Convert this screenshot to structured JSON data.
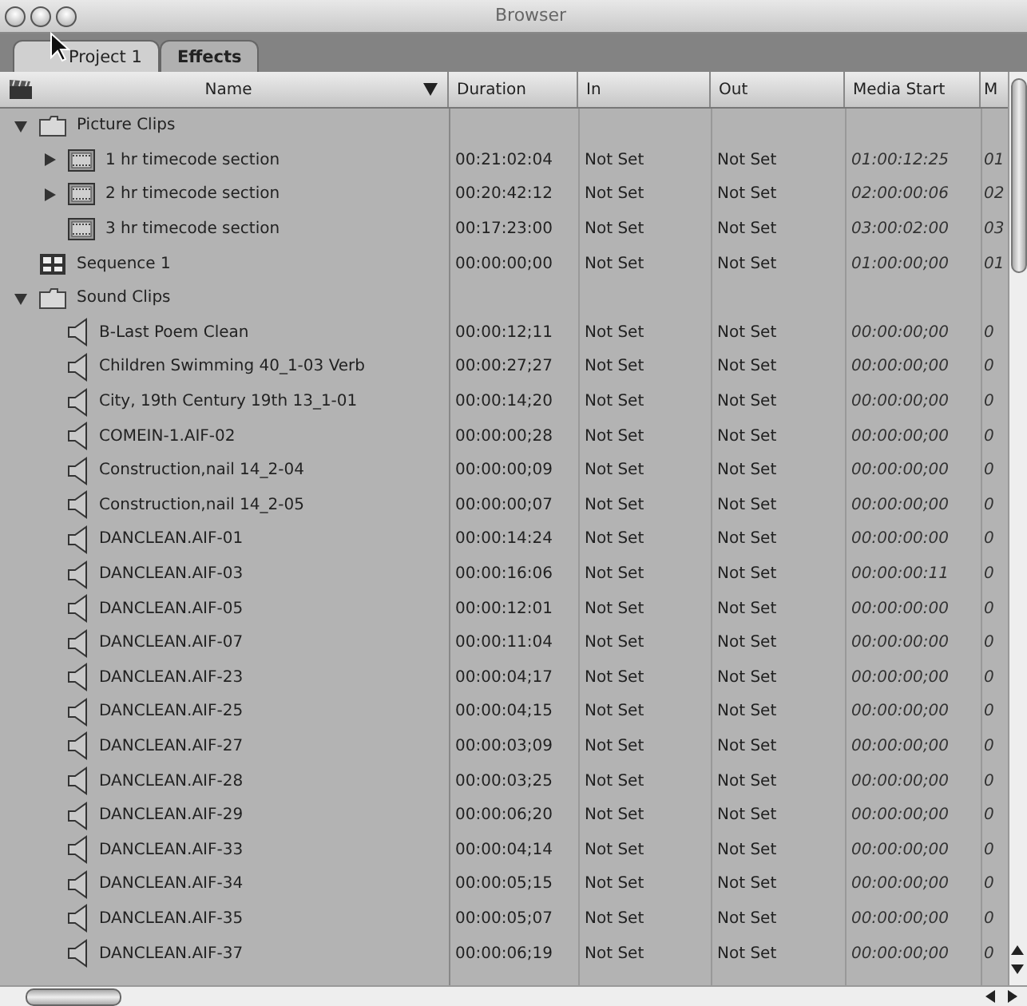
{
  "window": {
    "title": "Browser"
  },
  "tabs": [
    {
      "label": "Project 1",
      "selected": true
    },
    {
      "label": "Effects",
      "selected": false
    }
  ],
  "table": {
    "columns": [
      "Name",
      "Duration",
      "In",
      "Out",
      "Media Start",
      "M"
    ],
    "rows": [
      {
        "kind": "folder",
        "name": "Picture Clips",
        "expanded": true,
        "children": [
          {
            "kind": "clip",
            "name": "1 hr timecode section",
            "expanded": false,
            "cells": [
              "00:21:02:04",
              "Not Set",
              "Not Set",
              "01:00:12:25",
              "01"
            ]
          },
          {
            "kind": "clip",
            "name": "2 hr timecode section",
            "expanded": false,
            "cells": [
              "00:20:42:12",
              "Not Set",
              "Not Set",
              "02:00:00:06",
              "02"
            ]
          },
          {
            "kind": "clip",
            "name": "3 hr timecode section",
            "cells": [
              "00:17:23:00",
              "Not Set",
              "Not Set",
              "03:00:02:00",
              "03"
            ]
          }
        ]
      },
      {
        "kind": "sequence",
        "name": "Sequence 1",
        "cells": [
          "00:00:00;00",
          "Not Set",
          "Not Set",
          "01:00:00;00",
          "01"
        ]
      },
      {
        "kind": "folder",
        "name": "Sound Clips",
        "expanded": true,
        "children": [
          {
            "kind": "audio",
            "name": "B-Last Poem Clean",
            "cells": [
              "00:00:12;11",
              "Not Set",
              "Not Set",
              "00:00:00;00",
              "0"
            ]
          },
          {
            "kind": "audio",
            "name": "Children Swimming 40_1-03 Verb",
            "cells": [
              "00:00:27;27",
              "Not Set",
              "Not Set",
              "00:00:00;00",
              "0"
            ]
          },
          {
            "kind": "audio",
            "name": "City, 19th Century 19th 13_1-01",
            "cells": [
              "00:00:14;20",
              "Not Set",
              "Not Set",
              "00:00:00;00",
              "0"
            ]
          },
          {
            "kind": "audio",
            "name": "COMEIN-1.AIF-02",
            "cells": [
              "00:00:00;28",
              "Not Set",
              "Not Set",
              "00:00:00;00",
              "0"
            ]
          },
          {
            "kind": "audio",
            "name": "Construction,nail 14_2-04",
            "cells": [
              "00:00:00;09",
              "Not Set",
              "Not Set",
              "00:00:00;00",
              "0"
            ]
          },
          {
            "kind": "audio",
            "name": "Construction,nail 14_2-05",
            "cells": [
              "00:00:00;07",
              "Not Set",
              "Not Set",
              "00:00:00;00",
              "0"
            ]
          },
          {
            "kind": "audio",
            "name": "DANCLEAN.AIF-01",
            "cells": [
              "00:00:14:24",
              "Not Set",
              "Not Set",
              "00:00:00:00",
              "0"
            ]
          },
          {
            "kind": "audio",
            "name": "DANCLEAN.AIF-03",
            "cells": [
              "00:00:16:06",
              "Not Set",
              "Not Set",
              "00:00:00:11",
              "0"
            ]
          },
          {
            "kind": "audio",
            "name": "DANCLEAN.AIF-05",
            "cells": [
              "00:00:12:01",
              "Not Set",
              "Not Set",
              "00:00:00:00",
              "0"
            ]
          },
          {
            "kind": "audio",
            "name": "DANCLEAN.AIF-07",
            "cells": [
              "00:00:11:04",
              "Not Set",
              "Not Set",
              "00:00:00:00",
              "0"
            ]
          },
          {
            "kind": "audio",
            "name": "DANCLEAN.AIF-23",
            "cells": [
              "00:00:04;17",
              "Not Set",
              "Not Set",
              "00:00:00;00",
              "0"
            ]
          },
          {
            "kind": "audio",
            "name": "DANCLEAN.AIF-25",
            "cells": [
              "00:00:04;15",
              "Not Set",
              "Not Set",
              "00:00:00;00",
              "0"
            ]
          },
          {
            "kind": "audio",
            "name": "DANCLEAN.AIF-27",
            "cells": [
              "00:00:03;09",
              "Not Set",
              "Not Set",
              "00:00:00;00",
              "0"
            ]
          },
          {
            "kind": "audio",
            "name": "DANCLEAN.AIF-28",
            "cells": [
              "00:00:03;25",
              "Not Set",
              "Not Set",
              "00:00:00;00",
              "0"
            ]
          },
          {
            "kind": "audio",
            "name": "DANCLEAN.AIF-29",
            "cells": [
              "00:00:06;20",
              "Not Set",
              "Not Set",
              "00:00:00;00",
              "0"
            ]
          },
          {
            "kind": "audio",
            "name": "DANCLEAN.AIF-33",
            "cells": [
              "00:00:04;14",
              "Not Set",
              "Not Set",
              "00:00:00;00",
              "0"
            ]
          },
          {
            "kind": "audio",
            "name": "DANCLEAN.AIF-34",
            "cells": [
              "00:00:05;15",
              "Not Set",
              "Not Set",
              "00:00:00;00",
              "0"
            ]
          },
          {
            "kind": "audio",
            "name": "DANCLEAN.AIF-35",
            "cells": [
              "00:00:05;07",
              "Not Set",
              "Not Set",
              "00:00:00;00",
              "0"
            ]
          },
          {
            "kind": "audio",
            "name": "DANCLEAN.AIF-37",
            "cells": [
              "00:00:06;19",
              "Not Set",
              "Not Set",
              "00:00:00;00",
              "0"
            ]
          }
        ]
      }
    ]
  }
}
